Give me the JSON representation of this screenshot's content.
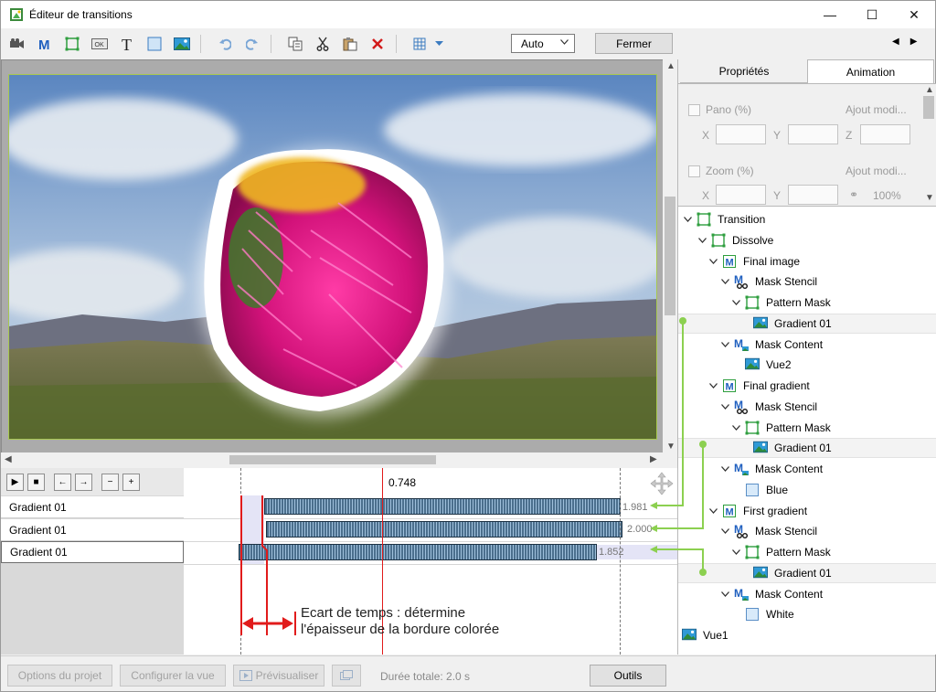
{
  "window": {
    "title": "Éditeur de transitions",
    "minimize": "—",
    "maximize": "☐",
    "close": "✕"
  },
  "toolbar": {
    "zoom_value": "Auto",
    "close_label": "Fermer",
    "nav_prev": "◀",
    "nav_next": "▶",
    "icons": [
      "video-icon",
      "mask-icon",
      "frame-icon",
      "button-icon",
      "text-icon",
      "rectangle-icon",
      "image-icon",
      "undo-icon",
      "redo-icon",
      "copy-icon",
      "cut-icon",
      "paste-icon",
      "delete-icon",
      "grid-icon"
    ]
  },
  "timeline": {
    "current_position": "0.748",
    "tracks": [
      {
        "label": "Gradient 01",
        "end_value": "1.981",
        "selected": false
      },
      {
        "label": "Gradient 01",
        "end_value": "2.000",
        "selected": false
      },
      {
        "label": "Gradient 01",
        "end_value": "1.852",
        "selected": true
      }
    ],
    "controls": [
      "▶",
      "■",
      "←",
      "→",
      "−",
      "+"
    ]
  },
  "annotation": {
    "line1": "Ecart de temps : détermine",
    "line2": "l'épaisseur de la bordure colorée"
  },
  "right_panel": {
    "tabs": [
      "Propriétés",
      "Animation"
    ],
    "active_tab": "Animation",
    "props": {
      "pan_label": "Pano  (%)",
      "pan_right": "Ajout modi...",
      "zoom_label": "Zoom  (%)",
      "zoom_right": "Ajout modi...",
      "x": "X",
      "y": "Y",
      "z": "Z",
      "zoom_pct": "100%"
    },
    "tree": [
      {
        "label": "Transition",
        "level": 0,
        "icon": "frame-icon",
        "expanded": true
      },
      {
        "label": "Dissolve",
        "level": 1,
        "icon": "frame-icon",
        "expanded": true
      },
      {
        "label": "Final image",
        "level": 2,
        "icon": "mask-container-icon",
        "expanded": true
      },
      {
        "label": "Mask Stencil",
        "level": 3,
        "icon": "stencil-icon",
        "expanded": true
      },
      {
        "label": "Pattern Mask",
        "level": 4,
        "icon": "frame-icon",
        "expanded": true
      },
      {
        "label": "Gradient 01",
        "level": 5,
        "icon": "image-icon",
        "selected": true
      },
      {
        "label": "Mask Content",
        "level": 3,
        "icon": "mask-content-icon",
        "expanded": true
      },
      {
        "label": "Vue2",
        "level": 4,
        "icon": "image-icon"
      },
      {
        "label": "Final gradient",
        "level": 2,
        "icon": "mask-container-icon",
        "expanded": true
      },
      {
        "label": "Mask Stencil",
        "level": 3,
        "icon": "stencil-icon",
        "expanded": true
      },
      {
        "label": "Pattern Mask",
        "level": 4,
        "icon": "frame-icon",
        "expanded": true
      },
      {
        "label": "Gradient 01",
        "level": 5,
        "icon": "image-icon",
        "selected": true
      },
      {
        "label": "Mask Content",
        "level": 3,
        "icon": "mask-content-icon",
        "expanded": true
      },
      {
        "label": "Blue",
        "level": 4,
        "icon": "color-rect-icon"
      },
      {
        "label": "First gradient",
        "level": 2,
        "icon": "mask-container-icon",
        "expanded": true
      },
      {
        "label": "Mask Stencil",
        "level": 3,
        "icon": "stencil-icon",
        "expanded": true
      },
      {
        "label": "Pattern Mask",
        "level": 4,
        "icon": "frame-icon",
        "expanded": true
      },
      {
        "label": "Gradient 01",
        "level": 5,
        "icon": "image-icon",
        "selected": true
      },
      {
        "label": "Mask Content",
        "level": 3,
        "icon": "mask-content-icon",
        "expanded": true
      },
      {
        "label": "White",
        "level": 4,
        "icon": "color-rect-icon"
      },
      {
        "label": "Vue1",
        "level": 0,
        "icon": "image-icon"
      }
    ]
  },
  "bottom": {
    "project_options": "Options du projet",
    "configure_view": "Configurer la vue",
    "preview": "Prévisualiser",
    "total_duration": "Durée totale: 2.0 s",
    "tools": "Outils"
  },
  "colors": {
    "accent_line": "#8cd050",
    "position_line": "#e11b1b",
    "bar_dark": "#4b6f8d",
    "bar_light": "#9fc0dc"
  }
}
